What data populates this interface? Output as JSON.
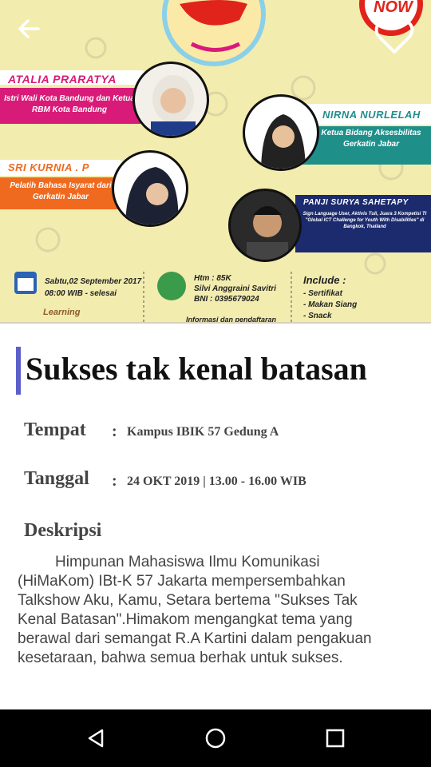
{
  "header": {
    "back_icon": "arrow-left-icon",
    "favorite_icon": "heart-outline-icon"
  },
  "poster": {
    "badge": "NOW",
    "speakers": [
      {
        "name": "ATALIA PRARATYA",
        "role": "Istri Wali Kota Bandung dan Ketua RBM Kota Bandung"
      },
      {
        "name": "NIRNA NURLELAH",
        "role": "Ketua Bidang Aksesbilitas Gerkatin Jabar"
      },
      {
        "name": "SRI KURNIA . P",
        "role": "Pelatih Bahasa Isyarat dari Gerkatin Jabar"
      },
      {
        "name": "PANJI SURYA SAHETAPY",
        "role": "Sign Language User, Aktivis Tuli, Juara 3 Kompetisi TI \"Global ICT Challenge for Youth With Disabilities\" di Bangkok, Thailand"
      }
    ],
    "schedule_line1": "Sabtu,02 September 2017",
    "schedule_line2": "08:00 WIB - selesai",
    "ticket_line1": "Htm : 85K",
    "ticket_line2": "Silvi Anggraini Savitri",
    "ticket_line3": "BNI : 0395679024",
    "include_title": "Include :",
    "include_items": [
      "- Sertifikat",
      "- Makan Siang",
      "- Snack"
    ],
    "learning": "Learning",
    "footer_info": "Informasi dan pendaftaran"
  },
  "event": {
    "title": "Sukses tak kenal batasan",
    "place_label": "Tempat",
    "place_value": "Kampus IBIK 57 Gedung A",
    "date_label": "Tanggal",
    "date_value": "24 OKT 2019 | 13.00 - 16.00 WIB",
    "colon": ":",
    "description_label": "Deskripsi",
    "description": "Himpunan Mahasiswa Ilmu Komunikasi (HiMaKom) IBt-K 57 Jakarta mempersembahkan Talkshow Aku, Kamu, Setara bertema \"Sukses Tak Kenal Batasan\".Himakom mengangkat tema yang berawal dari semangat R.A Kartini dalam pengakuan kesetaraan, bahwa semua berhak untuk sukses."
  },
  "navbar": {
    "back": "triangle-back-icon",
    "home": "circle-home-icon",
    "recents": "square-recents-icon"
  },
  "colors": {
    "accent_bar": "#5c5fc9",
    "magenta": "#d81b78",
    "teal": "#1f8f8a",
    "orange": "#ef6a1f",
    "navy": "#1c2a6e"
  }
}
